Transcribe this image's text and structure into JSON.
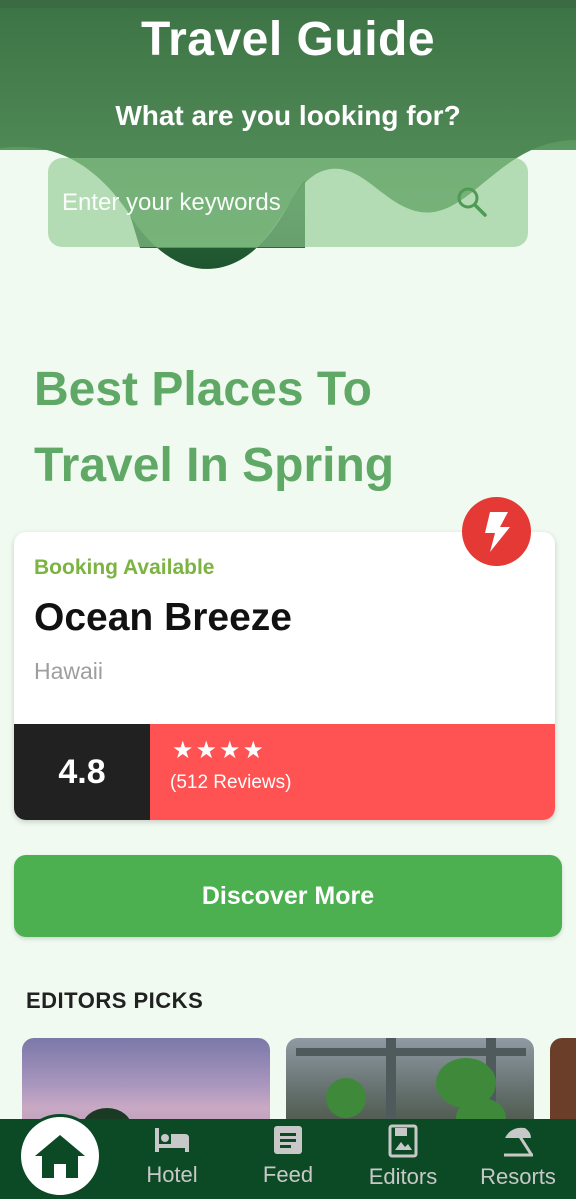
{
  "header": {
    "title": "Travel Guide",
    "subtitle": "What are you looking for?",
    "colors": {
      "dark_green": "#3a6b42",
      "mid_green": "#4f8c57"
    }
  },
  "search": {
    "placeholder": "Enter your keywords",
    "icon": "search-icon"
  },
  "headline": {
    "line1": "Best Places To",
    "line2": "Travel In Spring"
  },
  "featured": {
    "badge": "Booking Available",
    "name": "Ocean Breeze",
    "location": "Hawaii",
    "rating": "4.8",
    "stars": 4,
    "reviews": "(512 Reviews)",
    "flash_icon": "lightning-icon",
    "colors": {
      "badge": "#7cb342",
      "rating_bg": "#212121",
      "review_bg": "#ff5252",
      "flash": "#e53935"
    }
  },
  "discover_button": "Discover More",
  "editors_picks": {
    "title": "EDITORS PICKS"
  },
  "bottom_nav": {
    "items": [
      {
        "label": "",
        "icon": "home-icon"
      },
      {
        "label": "Hotel",
        "icon": "bed-icon"
      },
      {
        "label": "Feed",
        "icon": "article-icon"
      },
      {
        "label": "Editors",
        "icon": "photo-book-icon"
      },
      {
        "label": "Resorts",
        "icon": "beach-umbrella-icon"
      }
    ]
  }
}
